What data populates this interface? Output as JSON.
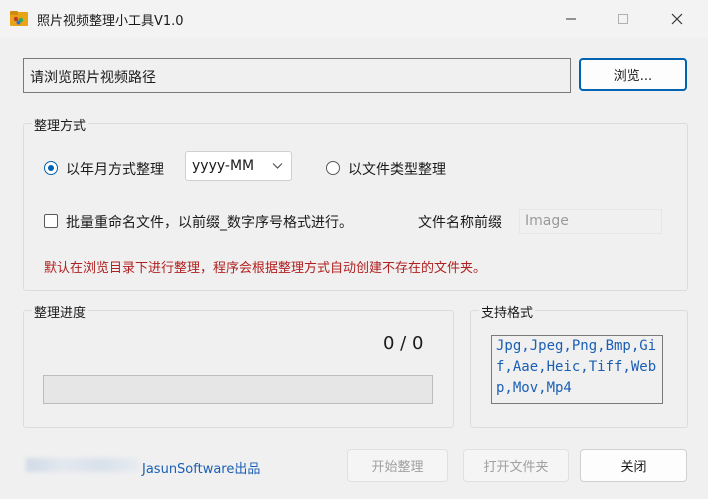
{
  "window": {
    "title": "照片视频整理小工具V1.0",
    "icon": "folder-photo-icon"
  },
  "path": {
    "placeholder": "请浏览照片视频路径",
    "browse_label": "浏览..."
  },
  "organize": {
    "group_label": "整理方式",
    "mode_date_label": "以年月方式整理",
    "mode_date_selected": true,
    "date_format": "yyyy-MM",
    "mode_type_label": "以文件类型整理",
    "mode_type_selected": false,
    "rename_label": "批量重命名文件，以前缀_数字序号格式进行。",
    "rename_checked": false,
    "prefix_label": "文件名称前缀",
    "prefix_value": "Image",
    "note": "默认在浏览目录下进行整理，程序会根据整理方式自动创建不存在的文件夹。"
  },
  "progress": {
    "group_label": "整理进度",
    "count": "0 / 0",
    "fraction": 0
  },
  "formats": {
    "group_label": "支持格式",
    "text": "Jpg,Jpeg,Png,Bmp,Gif,Aae,Heic,Tiff,Webp,Mov,Mp4"
  },
  "footer": {
    "credit": "JasunSoftware出品",
    "start_label": "开始整理",
    "open_folder_label": "打开文件夹",
    "close_label": "关闭"
  },
  "colors": {
    "accent": "#0063b1",
    "note_red": "#b02020",
    "link_blue": "#1a5fb4"
  }
}
